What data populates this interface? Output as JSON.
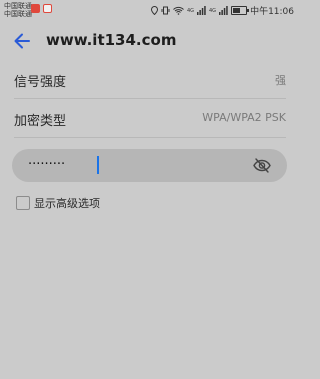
{
  "status_bar": {
    "carrier_1": "中国联通",
    "carrier_2": "中国联通",
    "signal_1": "4G",
    "signal_2": "4G",
    "time": "中午11:06",
    "battery_level": 0.55
  },
  "header": {
    "title": "www.it134.com",
    "back_icon": "arrow-left-icon"
  },
  "settings": {
    "signal_strength": {
      "label": "信号强度",
      "value": "强"
    },
    "encryption": {
      "label": "加密类型",
      "value": "WPA/WPA2 PSK"
    }
  },
  "password": {
    "value": "·········",
    "visibility_icon": "eye-slash-icon",
    "accent_color": "#1a73e8"
  },
  "advanced": {
    "label": "显示高级选项",
    "checked": false
  }
}
